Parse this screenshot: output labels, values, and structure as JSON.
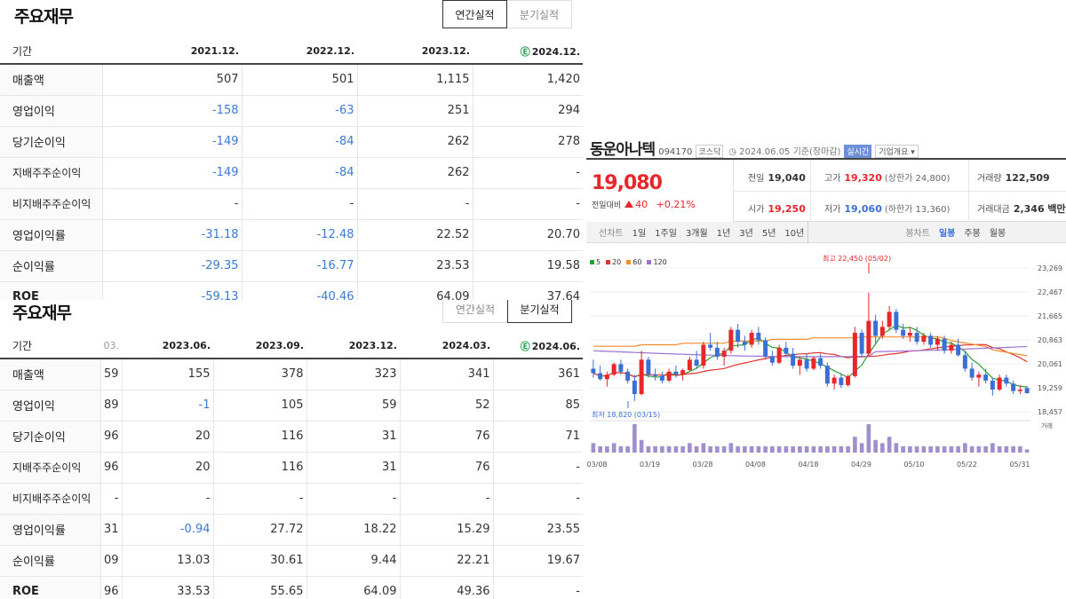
{
  "annual": {
    "title": "주요재무",
    "tabs": [
      "연간실적",
      "분기실적"
    ],
    "period_label": "기간",
    "estimate_mark": "Ⓔ",
    "headers": [
      "2021.12.",
      "2022.12.",
      "2023.12.",
      "2024.12."
    ],
    "rows": [
      {
        "label": "매출액",
        "values": [
          "507",
          "501",
          "1,115",
          "1,420"
        ]
      },
      {
        "label": "영업이익",
        "values": [
          "-158",
          "-63",
          "251",
          "294"
        ]
      },
      {
        "label": "당기순이익",
        "values": [
          "-149",
          "-84",
          "262",
          "278"
        ]
      },
      {
        "label": "지배주주순이익",
        "values": [
          "-149",
          "-84",
          "262",
          "-"
        ]
      },
      {
        "label": "비지배주주순이익",
        "values": [
          "-",
          "-",
          "-",
          "-"
        ]
      },
      {
        "label": "영업이익률",
        "values": [
          "-31.18",
          "-12.48",
          "22.52",
          "20.70"
        ]
      },
      {
        "label": "순이익률",
        "values": [
          "-29.35",
          "-16.77",
          "23.53",
          "19.58"
        ]
      },
      {
        "label": "ROE",
        "values": [
          "-59.13",
          "-40.46",
          "64.09",
          "37.64"
        ]
      }
    ]
  },
  "quarter": {
    "title": "주요재무",
    "tabs": [
      "연간실적",
      "분기실적"
    ],
    "period_label": "기간",
    "estimate_mark": "Ⓔ",
    "headers": [
      "03.",
      "2023.06.",
      "2023.09.",
      "2023.12.",
      "2024.03.",
      "2024.06."
    ],
    "rows": [
      {
        "label": "매출액",
        "values": [
          "59",
          "155",
          "378",
          "323",
          "341",
          "361"
        ]
      },
      {
        "label": "영업이익",
        "values": [
          "89",
          "-1",
          "105",
          "59",
          "52",
          "85"
        ]
      },
      {
        "label": "당기순이익",
        "values": [
          "96",
          "20",
          "116",
          "31",
          "76",
          "71"
        ]
      },
      {
        "label": "지배주주순이익",
        "values": [
          "96",
          "20",
          "116",
          "31",
          "76",
          "-"
        ]
      },
      {
        "label": "비지배주주순이익",
        "values": [
          "-",
          "-",
          "-",
          "-",
          "-",
          "-"
        ]
      },
      {
        "label": "영업이익률",
        "values": [
          "31",
          "-0.94",
          "27.72",
          "18.22",
          "15.29",
          "23.55"
        ]
      },
      {
        "label": "순이익률",
        "values": [
          "09",
          "13.03",
          "30.61",
          "9.44",
          "22.21",
          "19.67"
        ]
      },
      {
        "label": "ROE",
        "values": [
          "96",
          "33.53",
          "55.65",
          "64.09",
          "49.36",
          "-"
        ]
      }
    ]
  },
  "stock": {
    "name": "동운아나텍",
    "code": "094170",
    "market": "코스닥",
    "date": "2024.06.05 기준(장마감)",
    "live": "실시간",
    "company_info": "기업개요",
    "price": "19,080",
    "change_label": "전일대비",
    "change_amount": "40",
    "change_pct": "+0.21%",
    "quotes": {
      "prev_close": {
        "label": "전일",
        "value": "19,040"
      },
      "high": {
        "label": "고가",
        "value": "19,320",
        "sub": "(상한가 24,800)"
      },
      "volume": {
        "label": "거래량",
        "value": "122,509"
      },
      "open": {
        "label": "시가",
        "value": "19,250"
      },
      "low": {
        "label": "저가",
        "value": "19,060",
        "sub": "(하한가 13,360)"
      },
      "amount": {
        "label": "거래대금",
        "value": "2,346 백만"
      }
    },
    "range_tabs": [
      "선차트",
      "1일",
      "1주일",
      "3개월",
      "1년",
      "3년",
      "5년",
      "10년"
    ],
    "candle_label": "봉차트",
    "candle_tabs": [
      "일봉",
      "주봉",
      "월봉"
    ],
    "active_candle": "일봉"
  },
  "chart_data": {
    "type": "candlestick",
    "legend": [
      {
        "name": "5",
        "color": "#2ca02c"
      },
      {
        "name": "20",
        "color": "#e0352f"
      },
      {
        "name": "60",
        "color": "#f08c2a"
      },
      {
        "name": "120",
        "color": "#9b6fd1"
      }
    ],
    "y_ticks": [
      "23,269",
      "22,467",
      "21,665",
      "20,863",
      "20,061",
      "19,259",
      "18,457"
    ],
    "ylim": [
      18457,
      23269
    ],
    "x_ticks": [
      "03/08",
      "03/19",
      "03/28",
      "04/08",
      "04/18",
      "04/29",
      "05/10",
      "05/22",
      "05/31"
    ],
    "high_annotation": "최고 22,450 (05/02)",
    "low_annotation": "최저 18,820 (03/15)",
    "volume_label": "거래",
    "candles": [
      {
        "o": 19900,
        "h": 20200,
        "l": 19600,
        "c": 19750
      },
      {
        "o": 19750,
        "h": 20000,
        "l": 19500,
        "c": 19550
      },
      {
        "o": 19550,
        "h": 19800,
        "l": 19300,
        "c": 19700
      },
      {
        "o": 19700,
        "h": 20100,
        "l": 19650,
        "c": 20050
      },
      {
        "o": 20050,
        "h": 20200,
        "l": 19700,
        "c": 19800
      },
      {
        "o": 19800,
        "h": 19900,
        "l": 19400,
        "c": 19500
      },
      {
        "o": 19500,
        "h": 19700,
        "l": 18820,
        "c": 19050
      },
      {
        "o": 19050,
        "h": 20500,
        "l": 19000,
        "c": 20200
      },
      {
        "o": 20200,
        "h": 20300,
        "l": 19600,
        "c": 19700
      },
      {
        "o": 19700,
        "h": 19900,
        "l": 19500,
        "c": 19650
      },
      {
        "o": 19650,
        "h": 19800,
        "l": 19400,
        "c": 19500
      },
      {
        "o": 19500,
        "h": 19900,
        "l": 19450,
        "c": 19800
      },
      {
        "o": 19800,
        "h": 20000,
        "l": 19600,
        "c": 19700
      },
      {
        "o": 19700,
        "h": 19900,
        "l": 19500,
        "c": 19850
      },
      {
        "o": 19850,
        "h": 20300,
        "l": 19800,
        "c": 20200
      },
      {
        "o": 20200,
        "h": 20500,
        "l": 19900,
        "c": 20000
      },
      {
        "o": 20000,
        "h": 20800,
        "l": 19900,
        "c": 20700
      },
      {
        "o": 20700,
        "h": 21100,
        "l": 20500,
        "c": 20600
      },
      {
        "o": 20600,
        "h": 20800,
        "l": 20200,
        "c": 20300
      },
      {
        "o": 20300,
        "h": 20600,
        "l": 20000,
        "c": 20500
      },
      {
        "o": 20500,
        "h": 21300,
        "l": 20400,
        "c": 21200
      },
      {
        "o": 21200,
        "h": 21400,
        "l": 20600,
        "c": 20800
      },
      {
        "o": 20800,
        "h": 21000,
        "l": 20500,
        "c": 20700
      },
      {
        "o": 20700,
        "h": 21200,
        "l": 20600,
        "c": 21100
      },
      {
        "o": 21100,
        "h": 21300,
        "l": 20700,
        "c": 20850
      },
      {
        "o": 20850,
        "h": 20950,
        "l": 20200,
        "c": 20300
      },
      {
        "o": 20300,
        "h": 20500,
        "l": 20000,
        "c": 20100
      },
      {
        "o": 20100,
        "h": 20700,
        "l": 20050,
        "c": 20600
      },
      {
        "o": 20600,
        "h": 20800,
        "l": 20300,
        "c": 20400
      },
      {
        "o": 20400,
        "h": 20600,
        "l": 19900,
        "c": 20000
      },
      {
        "o": 20000,
        "h": 20300,
        "l": 19700,
        "c": 20200
      },
      {
        "o": 20200,
        "h": 20400,
        "l": 19800,
        "c": 19900
      },
      {
        "o": 19900,
        "h": 20300,
        "l": 19850,
        "c": 20250
      },
      {
        "o": 20250,
        "h": 20400,
        "l": 19900,
        "c": 20000
      },
      {
        "o": 20000,
        "h": 20100,
        "l": 19300,
        "c": 19400
      },
      {
        "o": 19400,
        "h": 19700,
        "l": 19200,
        "c": 19600
      },
      {
        "o": 19600,
        "h": 19750,
        "l": 19250,
        "c": 19350
      },
      {
        "o": 19350,
        "h": 19700,
        "l": 19300,
        "c": 19650
      },
      {
        "o": 19650,
        "h": 21300,
        "l": 19600,
        "c": 21100
      },
      {
        "o": 21100,
        "h": 21200,
        "l": 20300,
        "c": 20400
      },
      {
        "o": 20400,
        "h": 22450,
        "l": 20300,
        "c": 21500
      },
      {
        "o": 21500,
        "h": 21700,
        "l": 20700,
        "c": 21000
      },
      {
        "o": 21000,
        "h": 21500,
        "l": 20900,
        "c": 21300
      },
      {
        "o": 21300,
        "h": 22000,
        "l": 21200,
        "c": 21800
      },
      {
        "o": 21800,
        "h": 21900,
        "l": 21100,
        "c": 21200
      },
      {
        "o": 21200,
        "h": 21400,
        "l": 20900,
        "c": 21000
      },
      {
        "o": 21000,
        "h": 21300,
        "l": 20800,
        "c": 21100
      },
      {
        "o": 21100,
        "h": 21300,
        "l": 20700,
        "c": 20800
      },
      {
        "o": 20800,
        "h": 21100,
        "l": 20700,
        "c": 21000
      },
      {
        "o": 21000,
        "h": 21100,
        "l": 20600,
        "c": 20700
      },
      {
        "o": 20700,
        "h": 21000,
        "l": 20500,
        "c": 20900
      },
      {
        "o": 20900,
        "h": 21000,
        "l": 20400,
        "c": 20500
      },
      {
        "o": 20500,
        "h": 20800,
        "l": 20400,
        "c": 20700
      },
      {
        "o": 20700,
        "h": 20900,
        "l": 20300,
        "c": 20350
      },
      {
        "o": 20350,
        "h": 20500,
        "l": 19800,
        "c": 19900
      },
      {
        "o": 19900,
        "h": 20100,
        "l": 19500,
        "c": 19600
      },
      {
        "o": 19600,
        "h": 19800,
        "l": 19300,
        "c": 19700
      },
      {
        "o": 19700,
        "h": 19900,
        "l": 19400,
        "c": 19500
      },
      {
        "o": 19500,
        "h": 19600,
        "l": 19000,
        "c": 19200
      },
      {
        "o": 19200,
        "h": 19700,
        "l": 19150,
        "c": 19600
      },
      {
        "o": 19600,
        "h": 19700,
        "l": 19300,
        "c": 19400
      },
      {
        "o": 19400,
        "h": 19500,
        "l": 19050,
        "c": 19150
      },
      {
        "o": 19150,
        "h": 19350,
        "l": 19050,
        "c": 19200
      },
      {
        "o": 19250,
        "h": 19320,
        "l": 19060,
        "c": 19080
      }
    ],
    "volumes": [
      3,
      2,
      2,
      3,
      2,
      2,
      9,
      4,
      2,
      2,
      2,
      2,
      2,
      2,
      3,
      2,
      3,
      2,
      2,
      2,
      3,
      2,
      2,
      2,
      2,
      2,
      2,
      2,
      2,
      2,
      2,
      2,
      2,
      2,
      2,
      2,
      2,
      2,
      5,
      3,
      9,
      4,
      3,
      5,
      3,
      2,
      2,
      2,
      2,
      2,
      2,
      2,
      2,
      2,
      3,
      2,
      2,
      2,
      3,
      2,
      2,
      2,
      2,
      1
    ]
  }
}
